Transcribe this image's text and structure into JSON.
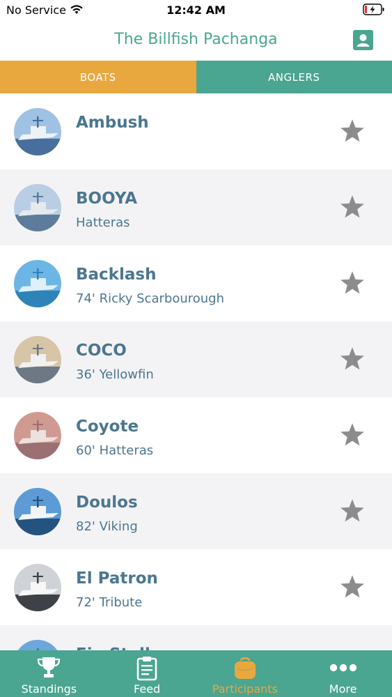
{
  "status": {
    "carrier": "No Service",
    "time": "12:42 AM"
  },
  "nav": {
    "title": "The Billfish Pachanga"
  },
  "tabs": {
    "boats": "BOATS",
    "anglers": "ANGLERS"
  },
  "boats": [
    {
      "name": "Ambush",
      "sub": "",
      "photo": [
        "#9fc1e4",
        "#486f9c",
        "#eef2f6"
      ]
    },
    {
      "name": "BOOYA",
      "sub": "Hatteras",
      "photo": [
        "#b9cee4",
        "#5d7c9b",
        "#e7e9ec"
      ]
    },
    {
      "name": "Backlash",
      "sub": "74' Ricky Scarbourough",
      "photo": [
        "#6cb6e6",
        "#2e84b8",
        "#dff0fa"
      ]
    },
    {
      "name": "COCO",
      "sub": "36' Yellowfin",
      "photo": [
        "#d7c5a8",
        "#6d7884",
        "#f1f1f1"
      ]
    },
    {
      "name": "Coyote",
      "sub": "60' Hatteras",
      "photo": [
        "#d19a91",
        "#9c6f73",
        "#ebe1de"
      ]
    },
    {
      "name": "Doulos",
      "sub": "82' Viking",
      "photo": [
        "#5c9bd6",
        "#25537f",
        "#f2f5f8"
      ]
    },
    {
      "name": "El Patron",
      "sub": "72' Tribute",
      "photo": [
        "#cfd3d7",
        "#3e4246",
        "#f7f7f7"
      ]
    },
    {
      "name": "Fin Stalker",
      "sub": "",
      "photo": [
        "#6ea7dc",
        "#3c6f9f",
        "#e8eef3"
      ]
    }
  ],
  "tabbar": [
    {
      "label": "Standings",
      "icon": "trophy-icon"
    },
    {
      "label": "Feed",
      "icon": "clipboard-icon"
    },
    {
      "label": "Participants",
      "icon": "participants-icon",
      "active": true
    },
    {
      "label": "More",
      "icon": "more-dots-icon"
    }
  ],
  "colors": {
    "teal": "#4aa591",
    "gold": "#e9a83e",
    "name": "#4b7690",
    "star": "#8c8c8c"
  }
}
